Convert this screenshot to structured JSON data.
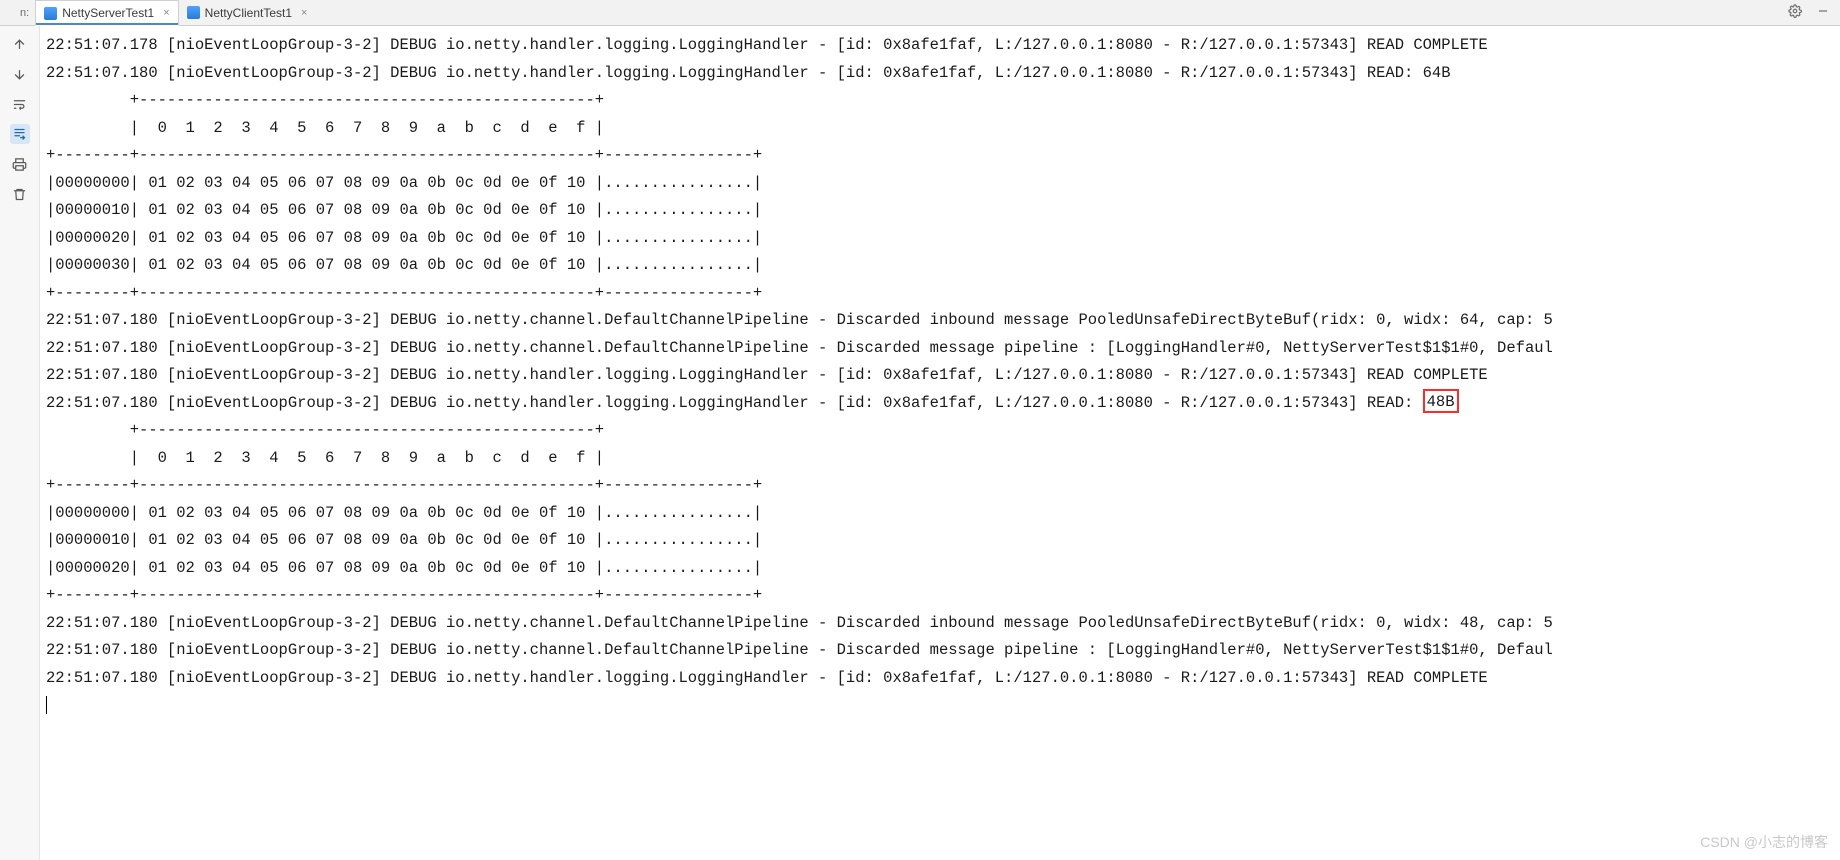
{
  "tabs": {
    "prefix": "n:",
    "items": [
      {
        "label": "NettyServerTest1",
        "active": true
      },
      {
        "label": "NettyClientTest1",
        "active": false
      }
    ]
  },
  "gutter": {
    "items": [
      {
        "name": "arrow-up-icon"
      },
      {
        "name": "arrow-down-icon"
      },
      {
        "name": "soft-wrap-icon"
      },
      {
        "name": "scroll-end-icon",
        "highlight": true
      },
      {
        "name": "print-icon"
      },
      {
        "name": "trash-icon"
      }
    ]
  },
  "titleIcons": {
    "gear": "gear-icon",
    "minimize": "minimize-icon"
  },
  "log": {
    "ts": "22:51:07",
    "ms1": "178",
    "ms2": "180",
    "thread": "[nioEventLoopGroup-3-2]",
    "lvl": "DEBUG",
    "logH": "io.netty.handler.logging.LoggingHandler",
    "pipe": "io.netty.channel.DefaultChannelPipeline",
    "chan": "[id: 0x8afe1faf, L:/127.0.0.1:8080 - R:/127.0.0.1:57343]",
    "readComplete": "READ COMPLETE",
    "read64": "READ: 64B",
    "read48_prefix": "READ: ",
    "read48_val": "48B",
    "discard64": "Discarded inbound message PooledUnsafeDirectByteBuf(ridx: 0, widx: 64, cap: 5",
    "discard48": "Discarded inbound message PooledUnsafeDirectByteBuf(ridx: 0, widx: 48, cap: 5",
    "discardPipe": "Discarded message pipeline : [LoggingHandler#0, NettyServerTest$1$1#0, Defaul",
    "hexHeaderTop": "         +-------------------------------------------------+",
    "hexHeaderCols": "         |  0  1  2  3  4  5  6  7  8  9  a  b  c  d  e  f |",
    "hexSep": "+--------+-------------------------------------------------+----------------+",
    "hexRows": [
      "|00000000| 01 02 03 04 05 06 07 08 09 0a 0b 0c 0d 0e 0f 10 |................|",
      "|00000010| 01 02 03 04 05 06 07 08 09 0a 0b 0c 0d 0e 0f 10 |................|",
      "|00000020| 01 02 03 04 05 06 07 08 09 0a 0b 0c 0d 0e 0f 10 |................|",
      "|00000030| 01 02 03 04 05 06 07 08 09 0a 0b 0c 0d 0e 0f 10 |................|"
    ]
  },
  "watermark": "CSDN @小志的博客"
}
